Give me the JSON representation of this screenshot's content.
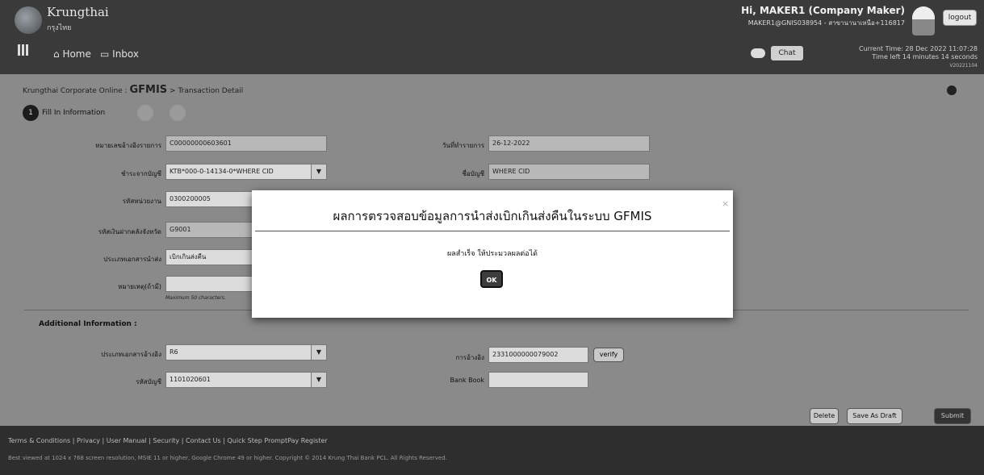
{
  "header": {
    "brand": "Krungthai",
    "brand_sub": "กรุงไทย",
    "nav": [
      "Home",
      "Inbox"
    ],
    "user_greeting": "Hi, MAKER1 (Company Maker)",
    "user_detail": "MAKER1@GNIS038954 - สาขานานาเหนือ+116817",
    "logout_label": "logout",
    "chat_label": "Chat",
    "current_time": "Current Time: 28 Dec 2022 11:07:28",
    "time_left": "Time left 14 minutes 14 seconds",
    "version": "V20221104"
  },
  "breadcrumb": {
    "prefix": "Krungthai Corporate Online :",
    "module": "GFMIS",
    "page": "> Transaction Detail"
  },
  "steps": {
    "current_number": "1",
    "current_label": "Fill In Information"
  },
  "form": {
    "ref_label": "หมายเลขอ้างอิงรายการ",
    "ref_value": "C00000000603601",
    "date_label": "วันที่ทำรายการ",
    "date_value": "26-12-2022",
    "from_account_label": "ชำระจากบัญชี",
    "from_account_value": "KTB*000-0-14134-0*WHERE CID",
    "account_name_label": "ชื่อบัญชี",
    "account_name_value": "WHERE CID",
    "fund_code_label": "รหัสหน่วยงาน",
    "fund_code_value": "0300200005",
    "group_code_label": "รหัสเงินฝากคลังจังหวัด",
    "group_code_value": "G9001",
    "doc_type_label": "ประเภทเอกสารนำส่ง",
    "doc_type_value": "เบิกเกินส่งคืน",
    "note_label": "หมายเหตุ(ถ้ามี)",
    "note_value": "",
    "note_hint": "Maximum 50 characters."
  },
  "additional": {
    "title": "Additional Information :",
    "ref_type_label": "ประเภทเอกสารอ้างอิง",
    "ref_type_value": "R6",
    "account_code_label": "รหัสบัญชี",
    "account_code_value": "1101020601",
    "ref_no_label": "การอ้างอิง",
    "ref_no_value": "2331000000079002",
    "verify_label": "verify",
    "bank_book_label": "Bank Book",
    "bank_book_value": ""
  },
  "actions": {
    "delete": "Delete",
    "save_draft": "Save As Draft",
    "submit": "Submit"
  },
  "footer": {
    "links": "Terms & Conditions  |  Privacy  |  User Manual  |  Security  |  Contact Us  |  Quick Step PromptPay Register",
    "copyright": "Best viewed at 1024 x 768 screen resolution, MSIE 11 or higher, Google Chrome 49 or higher. Copyright © 2014 Krung Thai Bank PCL. All Rights Reserved."
  },
  "modal": {
    "title": "ผลการตรวจสอบข้อมูลการนำส่งเบิกเกินส่งคืนในระบบ GFMIS",
    "close": "×",
    "message": "ผลสำเร็จ ให้ประมวลผลต่อได้",
    "ok_label": "OK"
  }
}
